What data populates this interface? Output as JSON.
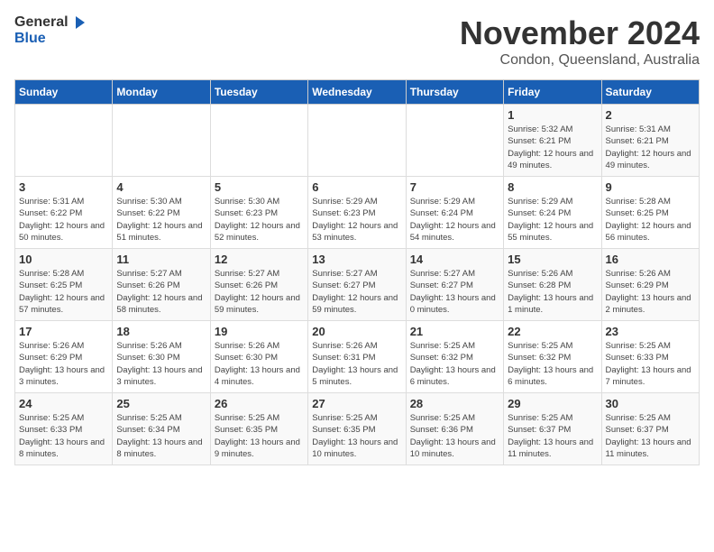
{
  "logo": {
    "general": "General",
    "blue": "Blue"
  },
  "title": "November 2024",
  "location": "Condon, Queensland, Australia",
  "days_header": [
    "Sunday",
    "Monday",
    "Tuesday",
    "Wednesday",
    "Thursday",
    "Friday",
    "Saturday"
  ],
  "weeks": [
    [
      {
        "day": "",
        "info": ""
      },
      {
        "day": "",
        "info": ""
      },
      {
        "day": "",
        "info": ""
      },
      {
        "day": "",
        "info": ""
      },
      {
        "day": "",
        "info": ""
      },
      {
        "day": "1",
        "info": "Sunrise: 5:32 AM\nSunset: 6:21 PM\nDaylight: 12 hours and 49 minutes."
      },
      {
        "day": "2",
        "info": "Sunrise: 5:31 AM\nSunset: 6:21 PM\nDaylight: 12 hours and 49 minutes."
      }
    ],
    [
      {
        "day": "3",
        "info": "Sunrise: 5:31 AM\nSunset: 6:22 PM\nDaylight: 12 hours and 50 minutes."
      },
      {
        "day": "4",
        "info": "Sunrise: 5:30 AM\nSunset: 6:22 PM\nDaylight: 12 hours and 51 minutes."
      },
      {
        "day": "5",
        "info": "Sunrise: 5:30 AM\nSunset: 6:23 PM\nDaylight: 12 hours and 52 minutes."
      },
      {
        "day": "6",
        "info": "Sunrise: 5:29 AM\nSunset: 6:23 PM\nDaylight: 12 hours and 53 minutes."
      },
      {
        "day": "7",
        "info": "Sunrise: 5:29 AM\nSunset: 6:24 PM\nDaylight: 12 hours and 54 minutes."
      },
      {
        "day": "8",
        "info": "Sunrise: 5:29 AM\nSunset: 6:24 PM\nDaylight: 12 hours and 55 minutes."
      },
      {
        "day": "9",
        "info": "Sunrise: 5:28 AM\nSunset: 6:25 PM\nDaylight: 12 hours and 56 minutes."
      }
    ],
    [
      {
        "day": "10",
        "info": "Sunrise: 5:28 AM\nSunset: 6:25 PM\nDaylight: 12 hours and 57 minutes."
      },
      {
        "day": "11",
        "info": "Sunrise: 5:27 AM\nSunset: 6:26 PM\nDaylight: 12 hours and 58 minutes."
      },
      {
        "day": "12",
        "info": "Sunrise: 5:27 AM\nSunset: 6:26 PM\nDaylight: 12 hours and 59 minutes."
      },
      {
        "day": "13",
        "info": "Sunrise: 5:27 AM\nSunset: 6:27 PM\nDaylight: 12 hours and 59 minutes."
      },
      {
        "day": "14",
        "info": "Sunrise: 5:27 AM\nSunset: 6:27 PM\nDaylight: 13 hours and 0 minutes."
      },
      {
        "day": "15",
        "info": "Sunrise: 5:26 AM\nSunset: 6:28 PM\nDaylight: 13 hours and 1 minute."
      },
      {
        "day": "16",
        "info": "Sunrise: 5:26 AM\nSunset: 6:29 PM\nDaylight: 13 hours and 2 minutes."
      }
    ],
    [
      {
        "day": "17",
        "info": "Sunrise: 5:26 AM\nSunset: 6:29 PM\nDaylight: 13 hours and 3 minutes."
      },
      {
        "day": "18",
        "info": "Sunrise: 5:26 AM\nSunset: 6:30 PM\nDaylight: 13 hours and 3 minutes."
      },
      {
        "day": "19",
        "info": "Sunrise: 5:26 AM\nSunset: 6:30 PM\nDaylight: 13 hours and 4 minutes."
      },
      {
        "day": "20",
        "info": "Sunrise: 5:26 AM\nSunset: 6:31 PM\nDaylight: 13 hours and 5 minutes."
      },
      {
        "day": "21",
        "info": "Sunrise: 5:25 AM\nSunset: 6:32 PM\nDaylight: 13 hours and 6 minutes."
      },
      {
        "day": "22",
        "info": "Sunrise: 5:25 AM\nSunset: 6:32 PM\nDaylight: 13 hours and 6 minutes."
      },
      {
        "day": "23",
        "info": "Sunrise: 5:25 AM\nSunset: 6:33 PM\nDaylight: 13 hours and 7 minutes."
      }
    ],
    [
      {
        "day": "24",
        "info": "Sunrise: 5:25 AM\nSunset: 6:33 PM\nDaylight: 13 hours and 8 minutes."
      },
      {
        "day": "25",
        "info": "Sunrise: 5:25 AM\nSunset: 6:34 PM\nDaylight: 13 hours and 8 minutes."
      },
      {
        "day": "26",
        "info": "Sunrise: 5:25 AM\nSunset: 6:35 PM\nDaylight: 13 hours and 9 minutes."
      },
      {
        "day": "27",
        "info": "Sunrise: 5:25 AM\nSunset: 6:35 PM\nDaylight: 13 hours and 10 minutes."
      },
      {
        "day": "28",
        "info": "Sunrise: 5:25 AM\nSunset: 6:36 PM\nDaylight: 13 hours and 10 minutes."
      },
      {
        "day": "29",
        "info": "Sunrise: 5:25 AM\nSunset: 6:37 PM\nDaylight: 13 hours and 11 minutes."
      },
      {
        "day": "30",
        "info": "Sunrise: 5:25 AM\nSunset: 6:37 PM\nDaylight: 13 hours and 11 minutes."
      }
    ]
  ]
}
